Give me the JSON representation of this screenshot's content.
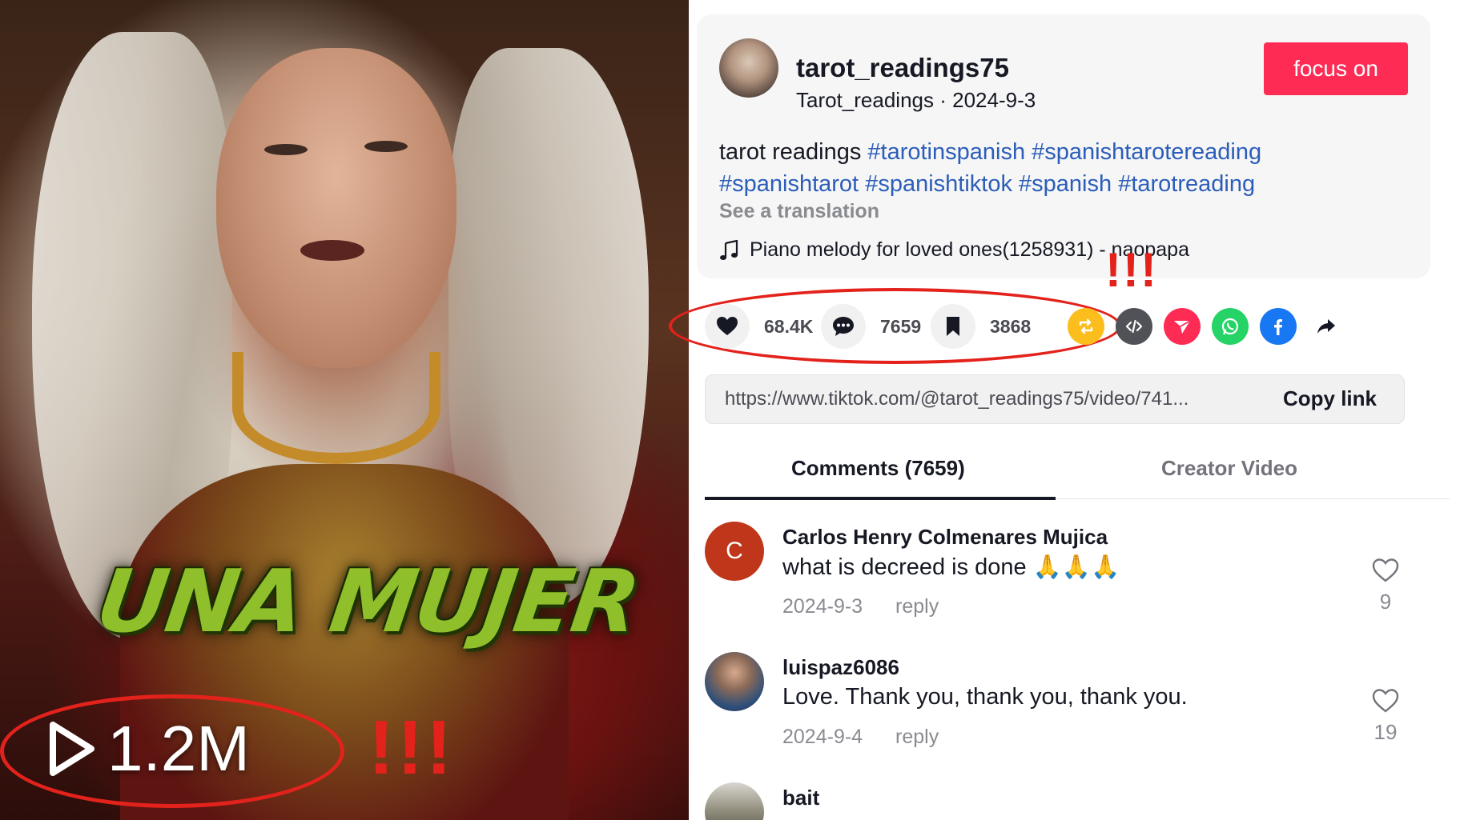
{
  "video": {
    "overlay_text": "UNA MUJER",
    "views": "1.2M",
    "annotation_marks": "!!!"
  },
  "post": {
    "username": "tarot_readings75",
    "nickname": "Tarot_readings",
    "date": "2024-9-3",
    "follow_label": "focus on",
    "caption_plain": "tarot readings ",
    "hashtags": [
      "#tarotinspanish",
      "#spanishtarotereading",
      "#spanishtarot",
      "#spanishtiktok",
      "#spanish",
      "#tarotreading"
    ],
    "see_translation": "See a translation",
    "music": "Piano melody for loved ones(1258931) - naopapa",
    "annotation_marks": "!!!"
  },
  "actions": {
    "likes": "68.4K",
    "comments": "7659",
    "saves": "3868"
  },
  "share_icons": [
    {
      "name": "repost-icon",
      "color": "#fcbe1d"
    },
    {
      "name": "embed-icon",
      "color": "#515257"
    },
    {
      "name": "send-icon",
      "color": "#fe2c55"
    },
    {
      "name": "whatsapp-icon",
      "color": "#25d366"
    },
    {
      "name": "facebook-icon",
      "color": "#1877f2"
    },
    {
      "name": "share-arrow-icon",
      "color": "#161823"
    }
  ],
  "link": {
    "url": "https://www.tiktok.com/@tarot_readings75/video/741...",
    "copy_label": "Copy link"
  },
  "tabs": {
    "comments": "Comments (7659)",
    "creator": "Creator Video"
  },
  "comments": [
    {
      "avatar_letter": "C",
      "name": "Carlos Henry Colmenares Mujica",
      "text": "what is decreed is done 🙏🙏🙏",
      "date": "2024-9-3",
      "reply": "reply",
      "likes": "9"
    },
    {
      "avatar_letter": "",
      "name": "luispaz6086",
      "text": "Love. Thank you, thank you, thank you.",
      "date": "2024-9-4",
      "reply": "reply",
      "likes": "19"
    },
    {
      "avatar_letter": "",
      "name": "bait",
      "text": "",
      "date": "",
      "reply": "",
      "likes": ""
    }
  ],
  "colors": {
    "brand": "#fe2c55",
    "hashtag": "#2b5db9",
    "annotation": "#e3221c"
  }
}
